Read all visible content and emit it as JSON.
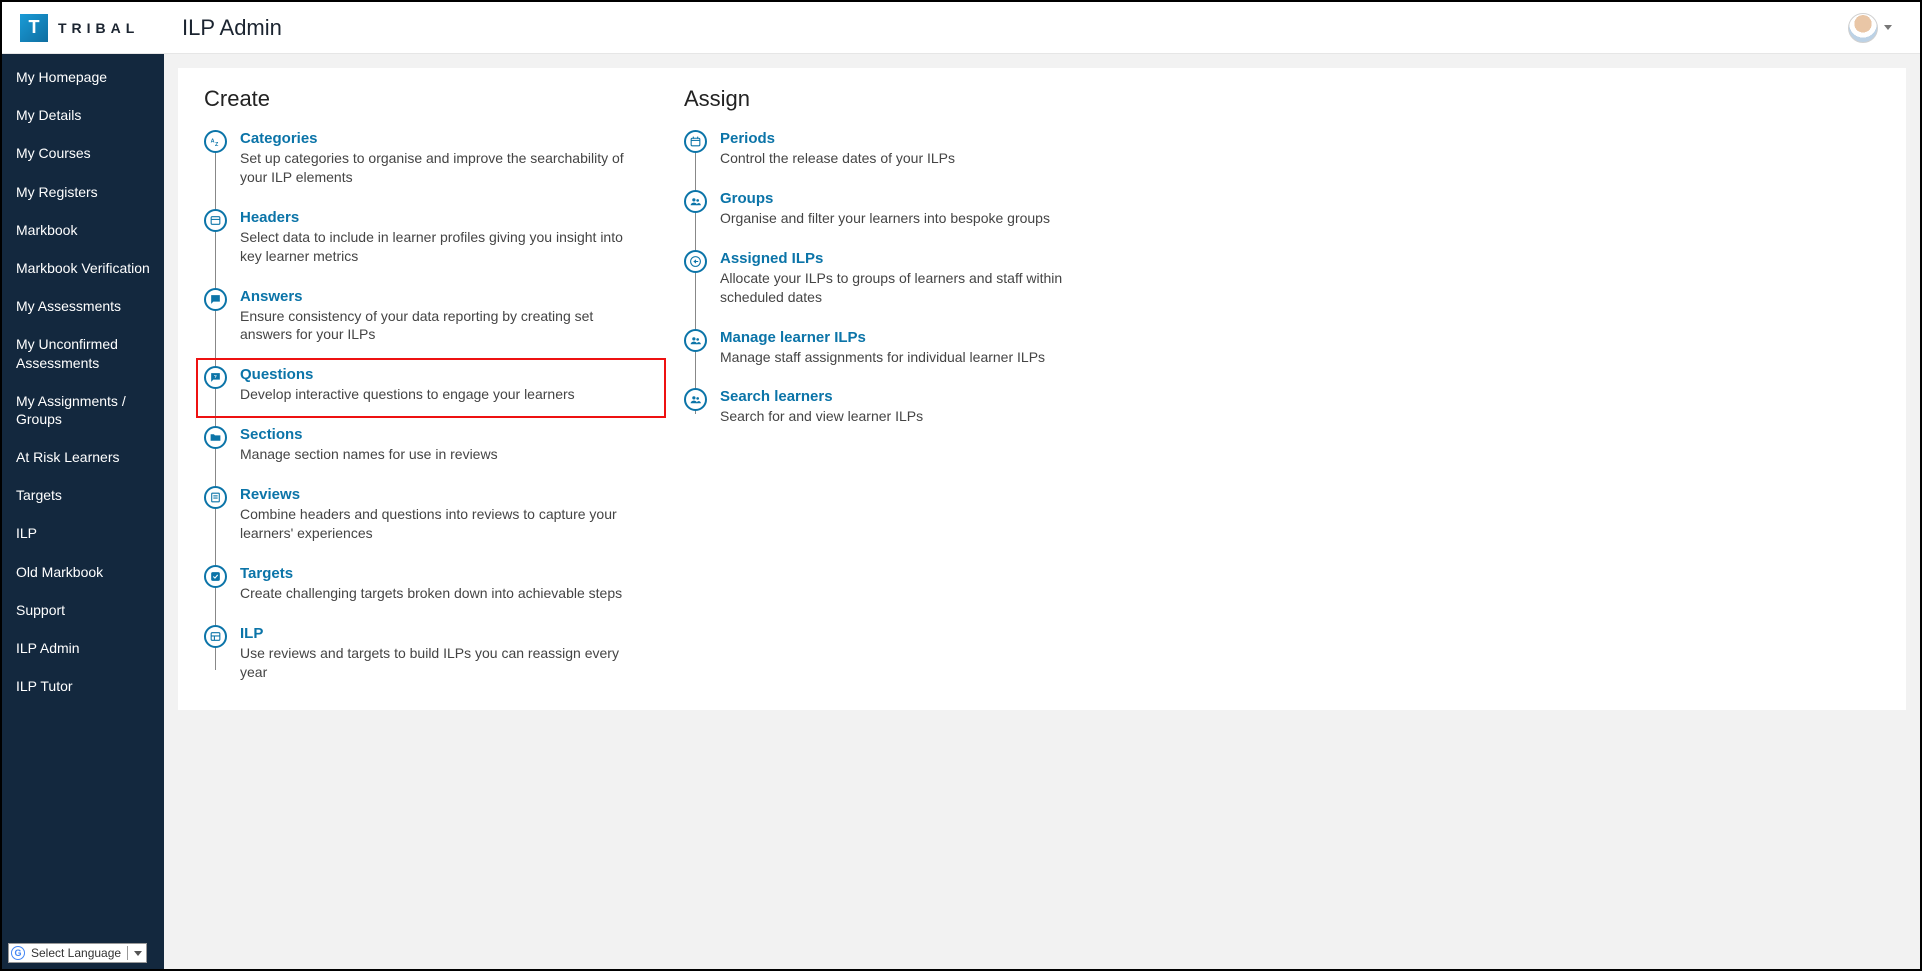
{
  "header": {
    "brand_letter": "T",
    "brand_text": "TRIBAL",
    "page_title": "ILP Admin"
  },
  "sidebar": {
    "items": [
      "My Homepage",
      "My Details",
      "My Courses",
      "My Registers",
      "Markbook",
      "Markbook Verification",
      "My Assessments",
      "My Unconfirmed Assessments",
      "My Assignments / Groups",
      "At Risk Learners",
      "Targets",
      "ILP",
      "Old Markbook",
      "Support",
      "ILP Admin",
      "ILP Tutor"
    ]
  },
  "lang": {
    "label": "Select Language"
  },
  "columns": {
    "create": {
      "heading": "Create",
      "items": [
        {
          "icon": "az-icon",
          "title": "Categories",
          "desc": "Set up categories to organise and improve the searchability of your ILP elements"
        },
        {
          "icon": "header-icon",
          "title": "Headers",
          "desc": "Select data to include in learner profiles giving you insight into key learner metrics"
        },
        {
          "icon": "chat-icon",
          "title": "Answers",
          "desc": "Ensure consistency of your data reporting by creating set answers for your ILPs"
        },
        {
          "icon": "question-icon",
          "title": "Questions",
          "desc": "Develop interactive questions to engage your learners",
          "highlight": true
        },
        {
          "icon": "folder-icon",
          "title": "Sections",
          "desc": "Manage section names for use in reviews"
        },
        {
          "icon": "review-icon",
          "title": "Reviews",
          "desc": "Combine headers and questions into reviews to capture your learners' experiences"
        },
        {
          "icon": "target-icon",
          "title": "Targets",
          "desc": "Create challenging targets broken down into achievable steps"
        },
        {
          "icon": "ilp-icon",
          "title": "ILP",
          "desc": "Use reviews and targets to build ILPs you can reassign every year"
        }
      ]
    },
    "assign": {
      "heading": "Assign",
      "items": [
        {
          "icon": "calendar-icon",
          "title": "Periods",
          "desc": "Control the release dates of your ILPs"
        },
        {
          "icon": "group-icon",
          "title": "Groups",
          "desc": "Organise and filter your learners into bespoke groups"
        },
        {
          "icon": "send-icon",
          "title": "Assigned ILPs",
          "desc": "Allocate your ILPs to groups of learners and staff within scheduled dates"
        },
        {
          "icon": "group-icon",
          "title": "Manage learner ILPs",
          "desc": "Manage staff assignments for individual learner ILPs"
        },
        {
          "icon": "group-icon",
          "title": "Search learners",
          "desc": "Search for and view learner ILPs"
        }
      ]
    }
  }
}
